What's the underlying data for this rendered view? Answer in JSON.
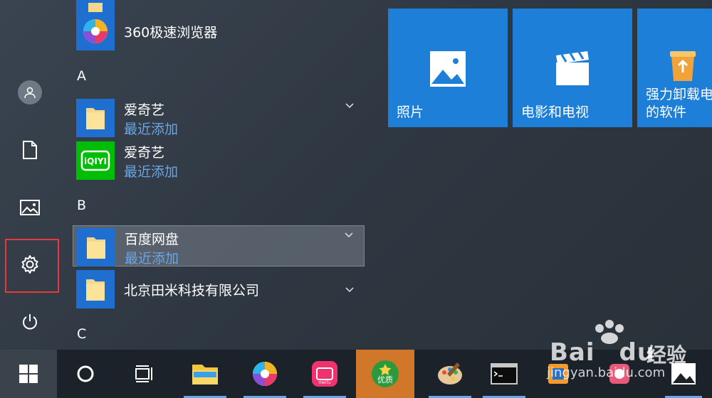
{
  "app_list": {
    "top_app": {
      "name": "360极速浏览器"
    },
    "sections": [
      {
        "letter": "A"
      },
      {
        "letter": "B"
      },
      {
        "letter": "C"
      }
    ],
    "items": [
      {
        "name": "爱奇艺",
        "sub": "最近添加",
        "icon": "folder-icon",
        "expandable": true
      },
      {
        "name": "爱奇艺",
        "sub": "最近添加",
        "icon": "iqiyi-icon",
        "expandable": false
      },
      {
        "name": "百度网盘",
        "sub": "最近添加",
        "icon": "folder-icon",
        "expandable": true,
        "selected": true
      },
      {
        "name": "北京田米科技有限公司",
        "icon": "folder-icon",
        "expandable": true
      }
    ]
  },
  "tiles": [
    {
      "label": "照片",
      "icon": "photos-icon"
    },
    {
      "label": "电影和电视",
      "icon": "movies-icon"
    },
    {
      "label": "强力卸载电\n的软件",
      "icon": "recycle-bin-icon"
    }
  ],
  "rail": {
    "items": [
      "avatar-icon",
      "document-icon",
      "pictures-icon",
      "settings-icon",
      "power-icon"
    ]
  },
  "taskbar": {
    "items": [
      "windows-start-icon",
      "cortana-icon",
      "task-view-icon",
      "file-explorer-icon",
      "browser-360-icon",
      "meitu-icon",
      "youzhi-icon",
      "paint-icon",
      "cmd-icon",
      "app-icon",
      "app-icon-2",
      "photos-taskbar-icon"
    ],
    "highlight_label": "优质"
  },
  "watermark": {
    "brand": "Bai",
    "brand2": "du",
    "cn": "经验",
    "url": "jingyan.baidu.com"
  },
  "colors": {
    "accent": "#1e7fd9",
    "highlight": "#e8383d",
    "taskbar": "#1c2229"
  }
}
